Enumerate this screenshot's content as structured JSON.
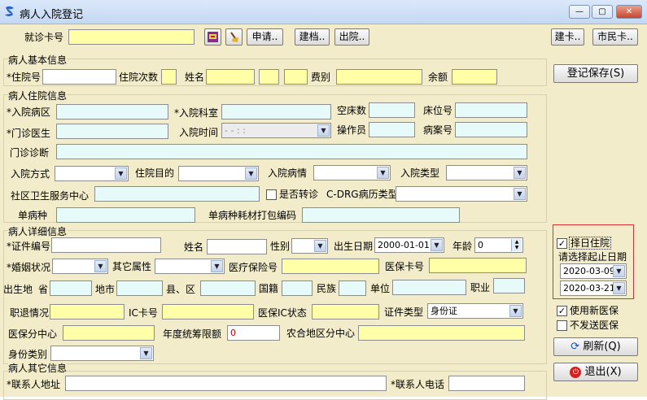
{
  "window": {
    "title": "病人入院登记",
    "min": "—",
    "max": "▢",
    "close": "✕"
  },
  "top": {
    "card_label": "就诊卡号",
    "card_value": "",
    "apply_btn": "申请..",
    "file_btn": "建档..",
    "discharge_btn": "出院..",
    "create_card_btn": "建卡..",
    "citizen_card_btn": "市民卡.."
  },
  "basic": {
    "group": "病人基本信息",
    "admission_no_label": "*住院号",
    "admission_count_label": "住院次数",
    "name_label": "姓名",
    "fee_label": "费别",
    "balance_label": "余额"
  },
  "hosp": {
    "group": "病人住院信息",
    "ward_label": "*入院病区",
    "dept_label": "*入院科室",
    "empty_bed_label": "空床数",
    "bed_no_label": "床位号",
    "clinic_doctor_label": "*门诊医生",
    "admit_time_label": "入院时间",
    "admit_time_value": "-  -      :   :",
    "operator_label": "操作员",
    "record_no_label": "病案号",
    "clinic_diag_label": "门诊诊断",
    "admit_mode_label": "入院方式",
    "purpose_label": "住院目的",
    "condition_label": "入院病情",
    "type_label": "入院类型",
    "community_label": "社区卫生服务中心",
    "transfer_label": "是否转诊",
    "cdrg_label": "C-DRG病历类型",
    "single_label": "单病种",
    "single_code_label": "单病种耗材打包编码"
  },
  "detail": {
    "group": "病人详细信息",
    "id_no_label": "*证件编号",
    "name_label": "姓名",
    "sex_label": "性别",
    "birth_label": "出生日期",
    "birth_value": "2000-01-01",
    "age_label": "年龄",
    "age_value": "0",
    "marital_label": "*婚姻状况",
    "other_label": "其它属性",
    "insurance_no_label": "医疗保险号",
    "med_card_label": "医保卡号",
    "birthplace_label": "出生地",
    "province_label": "省",
    "city_label": "地市",
    "county_label": "县、区",
    "nation_label": "国籍",
    "ethnic_label": "民族",
    "work_label": "单位",
    "job_label": "职业",
    "retire_label": "职退情况",
    "ic_label": "IC卡号",
    "ic_status_label": "医保IC状态",
    "id_type_label": "证件类型",
    "id_type_value": "身份证",
    "center_label": "医保分中心",
    "annual_label": "年度统筹限额",
    "annual_value": "0",
    "rural_label": "农合地区分中心",
    "identity_label": "身份类别"
  },
  "other": {
    "group": "病人其它信息",
    "contact_addr_label": "*联系人地址",
    "contact_phone_label": "*联系人电话"
  },
  "right": {
    "save_btn": "登记保存(S)",
    "select_day_label": "择日住院",
    "select_day_checked": true,
    "range_label": "请选择起止日期",
    "start_date": "2020-03-09",
    "end_date": "2020-03-21",
    "new_insurance_label": "使用新医保",
    "new_insurance_checked": true,
    "no_send_label": "不发送医保",
    "no_send_checked": false,
    "refresh_btn": "刷新(Q)",
    "exit_btn": "退出(X)"
  },
  "colors": {
    "client_bg": "#f2eccb",
    "yellow_field": "#ffffa8",
    "cyan_field": "#e6fafa",
    "highlight_border": "#e03030"
  }
}
